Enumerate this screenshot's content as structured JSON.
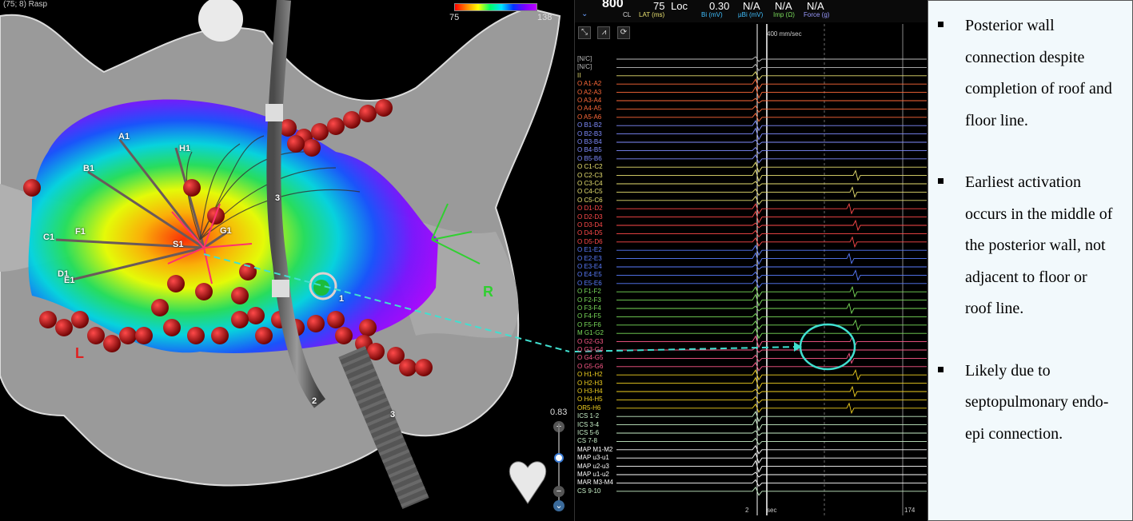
{
  "map": {
    "top_label": "(75; 8) Rasp",
    "scale_min": "75",
    "scale_max": "138",
    "zoom_value": "0.83",
    "zoom_level": 0.58,
    "zoom_plus": "+",
    "zoom_minus": "−",
    "electrode_labels": [
      "A1",
      "H1",
      "B1",
      "G1",
      "S1",
      "C1",
      "F1",
      "D1",
      "E1"
    ],
    "catheter_labels": [
      "3",
      "1",
      "2",
      "1",
      "3"
    ],
    "side_label_left": "L",
    "side_label_right": "R",
    "colors": {
      "accent_cyan": "#40e0d0",
      "lesion_red": "#b00000"
    }
  },
  "egm": {
    "header": {
      "cl_value": "800",
      "cl_label": "CL",
      "lat_value": "75",
      "lat_unit": "Loc",
      "lat_label": "LAT (ms)",
      "bi_value": "0.30",
      "bi_label": "Bi (mV)",
      "ubi_value": "N/A",
      "ubi_label": "µBi (mV)",
      "imp_value": "N/A",
      "imp_label": "Imp (Ω)",
      "force_value": "N/A",
      "force_label": "Force (g)"
    },
    "tools": [
      "⤡",
      "⩘",
      "⟳"
    ],
    "sweep_speed": "400 mm/sec",
    "foot_left": "2",
    "foot_mid": "sec",
    "foot_right": "174",
    "channels": [
      {
        "label": "[N/C]",
        "color": "#bbbbbb"
      },
      {
        "label": "[N/C]",
        "color": "#bbbbbb"
      },
      {
        "label": "II",
        "color": "#e8e070"
      },
      {
        "label": "O A1-A2",
        "color": "#ff6a3a"
      },
      {
        "label": "O A2-A3",
        "color": "#ff6a3a"
      },
      {
        "label": "O A3-A4",
        "color": "#ff6a3a"
      },
      {
        "label": "O A4-A5",
        "color": "#ff6a3a"
      },
      {
        "label": "O A5-A6",
        "color": "#ff6a3a"
      },
      {
        "label": "O B1-B2",
        "color": "#7f8cff"
      },
      {
        "label": "O B2-B3",
        "color": "#7f8cff"
      },
      {
        "label": "O B3-B4",
        "color": "#7f8cff"
      },
      {
        "label": "O B4-B5",
        "color": "#7f8cff"
      },
      {
        "label": "O B5-B6",
        "color": "#7f8cff"
      },
      {
        "label": "O C1-C2",
        "color": "#e8e070"
      },
      {
        "label": "O C2-C3",
        "color": "#e8e070"
      },
      {
        "label": "O C3-C4",
        "color": "#e8e070"
      },
      {
        "label": "O C4-C5",
        "color": "#e8e070"
      },
      {
        "label": "O C5-C6",
        "color": "#e8e070"
      },
      {
        "label": "O D1-D2",
        "color": "#ff4a4a"
      },
      {
        "label": "O D2-D3",
        "color": "#ff4a4a"
      },
      {
        "label": "O D3-D4",
        "color": "#ff4a4a"
      },
      {
        "label": "O D4-D5",
        "color": "#ff4a4a"
      },
      {
        "label": "O D5-D6",
        "color": "#ff4a4a"
      },
      {
        "label": "O E1-E2",
        "color": "#5a7dff"
      },
      {
        "label": "O E2-E3",
        "color": "#5a7dff"
      },
      {
        "label": "O E3-E4",
        "color": "#5a7dff"
      },
      {
        "label": "O E4-E5",
        "color": "#5a7dff"
      },
      {
        "label": "O E5-E6",
        "color": "#5a7dff"
      },
      {
        "label": "O F1-F2",
        "color": "#7adc5a"
      },
      {
        "label": "O F2-F3",
        "color": "#7adc5a"
      },
      {
        "label": "O F3-F4",
        "color": "#7adc5a"
      },
      {
        "label": "O F4-F5",
        "color": "#7adc5a"
      },
      {
        "label": "O F5-F6",
        "color": "#7adc5a"
      },
      {
        "label": "M G1-G2",
        "color": "#7adc5a"
      },
      {
        "label": "O G2-G3",
        "color": "#ff5a8a"
      },
      {
        "label": "O G3-G4",
        "color": "#ff5a8a"
      },
      {
        "label": "O G4-G5",
        "color": "#ff5a8a"
      },
      {
        "label": "O G5-G6",
        "color": "#ff5a8a"
      },
      {
        "label": "O H1-H2",
        "color": "#f0d020"
      },
      {
        "label": "O H2-H3",
        "color": "#f0d020"
      },
      {
        "label": "O H3-H4",
        "color": "#f0d020"
      },
      {
        "label": "O H4-H5",
        "color": "#f0d020"
      },
      {
        "label": "OR5-H6",
        "color": "#f0d020"
      },
      {
        "label": "ICS 1-2",
        "color": "#c8f0c8"
      },
      {
        "label": "ICS 3-4",
        "color": "#c8f0c8"
      },
      {
        "label": "ICS 5-6",
        "color": "#c8f0c8"
      },
      {
        "label": "CS 7-8",
        "color": "#c8f0c8"
      },
      {
        "label": "MAP M1-M2",
        "color": "#ffffff"
      },
      {
        "label": "MAP u3-u1",
        "color": "#ffffff"
      },
      {
        "label": "MAP u2-u3",
        "color": "#ffffff"
      },
      {
        "label": "MAP u1-u2",
        "color": "#ffffff"
      },
      {
        "label": "MAR M3-M4",
        "color": "#ffffff"
      },
      {
        "label": "CS 9-10",
        "color": "#c8f0c8"
      }
    ]
  },
  "notes": {
    "items": [
      "Posterior wall connection despite completion of roof and floor line.",
      "Earliest activation occurs in the middle of the posterior wall, not adjacent to floor or roof line.",
      "Likely due to septopulmonary endo-epi connection."
    ]
  }
}
